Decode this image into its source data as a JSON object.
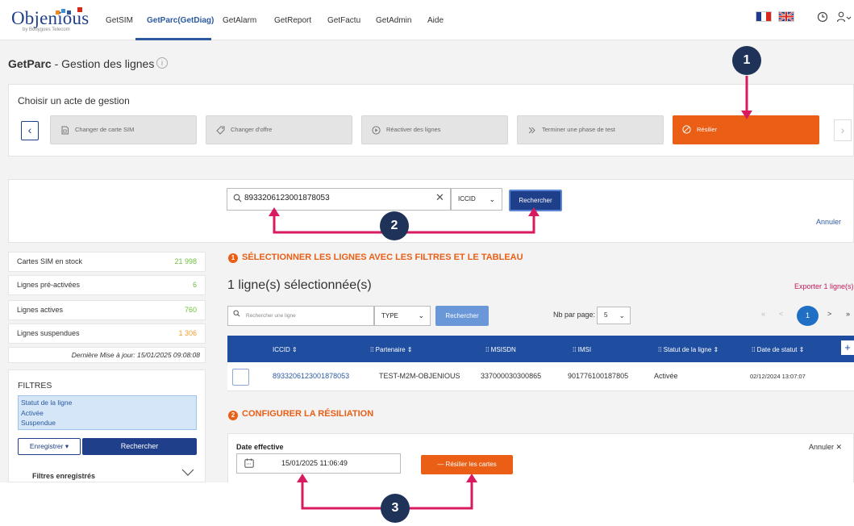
{
  "brand": {
    "name": "Objenious",
    "tagline": "by Bouygues Telecom"
  },
  "nav": {
    "items": [
      {
        "label": "GetSIM"
      },
      {
        "label": "GetParc(GetDiag)"
      },
      {
        "label": "GetAlarm"
      },
      {
        "label": "GetReport"
      },
      {
        "label": "GetFactu"
      },
      {
        "label": "GetAdmin"
      },
      {
        "label": "Aide"
      }
    ],
    "active": "GetParc(GetDiag)"
  },
  "page": {
    "title_bold": "GetParc",
    "title_rest": " - Gestion des lignes"
  },
  "acte": {
    "title": "Choisir un acte de gestion",
    "buttons": [
      {
        "label": "Changer de carte SIM",
        "icon": "sim-card-icon"
      },
      {
        "label": "Changer d'offre",
        "icon": "tag-icon"
      },
      {
        "label": "Réactiver des lignes",
        "icon": "play-icon"
      },
      {
        "label": "Terminer une phase de test",
        "icon": "double-chevron-icon"
      },
      {
        "label": "Résilier",
        "icon": "cancel-icon",
        "selected": true
      }
    ]
  },
  "search": {
    "value": "8933206123001878053",
    "type": "ICCID",
    "submit_label": "Rechercher",
    "cancel_label": "Annuler"
  },
  "stats": {
    "rows": [
      {
        "label": "Cartes SIM en stock",
        "value": "21 998"
      },
      {
        "label": "Lignes pré-activées",
        "value": "6"
      },
      {
        "label": "Lignes actives",
        "value": "760"
      },
      {
        "label": "Lignes suspendues",
        "value": "1 306"
      }
    ],
    "last_update": "Dernière Mise à jour: 15/01/2025 09:08:08"
  },
  "filters": {
    "title": "FILTRES",
    "chip_lines": [
      "Statut de la ligne",
      "Activée",
      "Suspendue"
    ],
    "save_label": "Enregistrer ▾",
    "search_label": "Rechercher",
    "saved_label": "Filtres enregistrés"
  },
  "step1": {
    "number": "1",
    "title": "SÉLECTIONNER LES LIGNES AVEC LES FILTRES ET LE TABLEAU",
    "selected_count": "1 ligne(s) sélectionnée(s)",
    "export_label": "Exporter 1 ligne(s)",
    "row_search_placeholder": "Rechercher une ligne",
    "type_label": "TYPE",
    "search_label": "Rechercher",
    "nb_par_page_label": "Nb par page:",
    "nb_par_page_value": "5",
    "pagination": {
      "first": "«",
      "prev": "<",
      "current": "1",
      "next": ">",
      "last": "»"
    }
  },
  "table": {
    "columns": [
      "ICCID",
      "Partenaire",
      "MSISDN",
      "IMSI",
      "Statut de la ligne",
      "Date de statut"
    ],
    "rows": [
      {
        "iccid": "8933206123001878053",
        "partenaire": "TEST-M2M-OBJENIOUS",
        "msisdn": "337000030300865",
        "imsi": "901776100187805",
        "statut": "Activée",
        "date": "02/12/2024 13:07:07"
      }
    ]
  },
  "step2": {
    "number": "2",
    "title": "CONFIGURER LA RÉSILIATION",
    "date_label": "Date effective",
    "date_value": "15/01/2025 11:06:49",
    "submit_label": "— Résilier les cartes",
    "cancel_label": "Annuler ✕"
  },
  "callouts": [
    "1",
    "2",
    "3"
  ],
  "colors": {
    "brand_blue": "#1f3f8a",
    "table_header": "#1f4da0",
    "accent_orange": "#ea5e15",
    "annotation_magenta": "#d81b60",
    "callout_navy": "#1f3258",
    "stat_green": "#6cbf3c",
    "stat_orange": "#f39c30"
  }
}
